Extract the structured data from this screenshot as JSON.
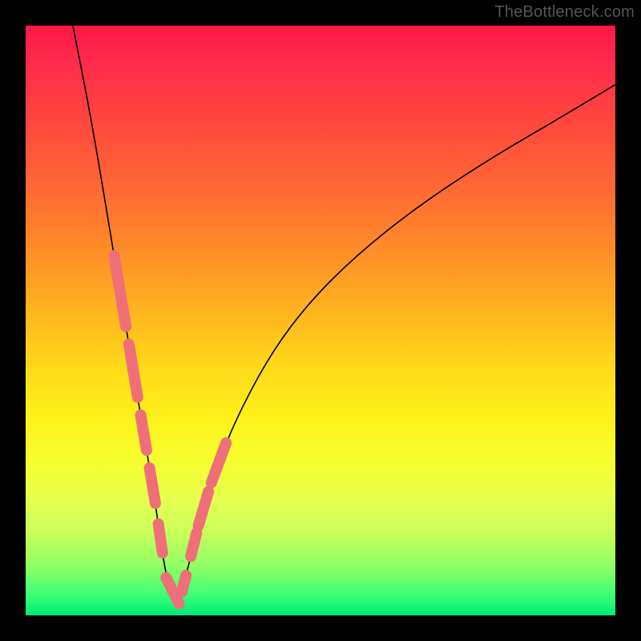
{
  "watermark": "TheBottleneck.com",
  "colors": {
    "segment": "#ef6f78",
    "curve": "#000000",
    "frame": "#000000"
  },
  "chart_data": {
    "type": "line",
    "title": "",
    "xlabel": "",
    "ylabel": "",
    "xlim": [
      0,
      100
    ],
    "ylim": [
      0,
      100
    ],
    "grid": false,
    "description": "V-shaped bottleneck curve; minimum near x≈24. Left branch nearly vertical, right branch sweeps up to the right with decreasing slope.",
    "series": [
      {
        "name": "bottleneck-curve",
        "x": [
          8,
          10,
          12,
          14,
          16,
          18,
          20,
          22,
          24,
          26,
          28,
          30,
          33,
          37,
          42,
          48,
          56,
          66,
          78,
          90,
          100
        ],
        "values": [
          100,
          90,
          79,
          67,
          55,
          43,
          31,
          19,
          5,
          2,
          10,
          18,
          27,
          36,
          45,
          53,
          61,
          69,
          77,
          84,
          90
        ]
      }
    ],
    "highlighted_segments": [
      {
        "x_range": [
          15,
          17
        ],
        "side": "left"
      },
      {
        "x_range": [
          17.5,
          19
        ],
        "side": "left"
      },
      {
        "x_range": [
          19.5,
          20.5
        ],
        "side": "left"
      },
      {
        "x_range": [
          21,
          22
        ],
        "side": "left"
      },
      {
        "x_range": [
          22.5,
          23.2
        ],
        "side": "left"
      },
      {
        "x_range": [
          23.8,
          26
        ],
        "side": "bottom"
      },
      {
        "x_range": [
          26.5,
          27.2
        ],
        "side": "right"
      },
      {
        "x_range": [
          28,
          29
        ],
        "side": "right"
      },
      {
        "x_range": [
          29.3,
          31
        ],
        "side": "right"
      },
      {
        "x_range": [
          31.5,
          34
        ],
        "side": "right"
      }
    ]
  }
}
